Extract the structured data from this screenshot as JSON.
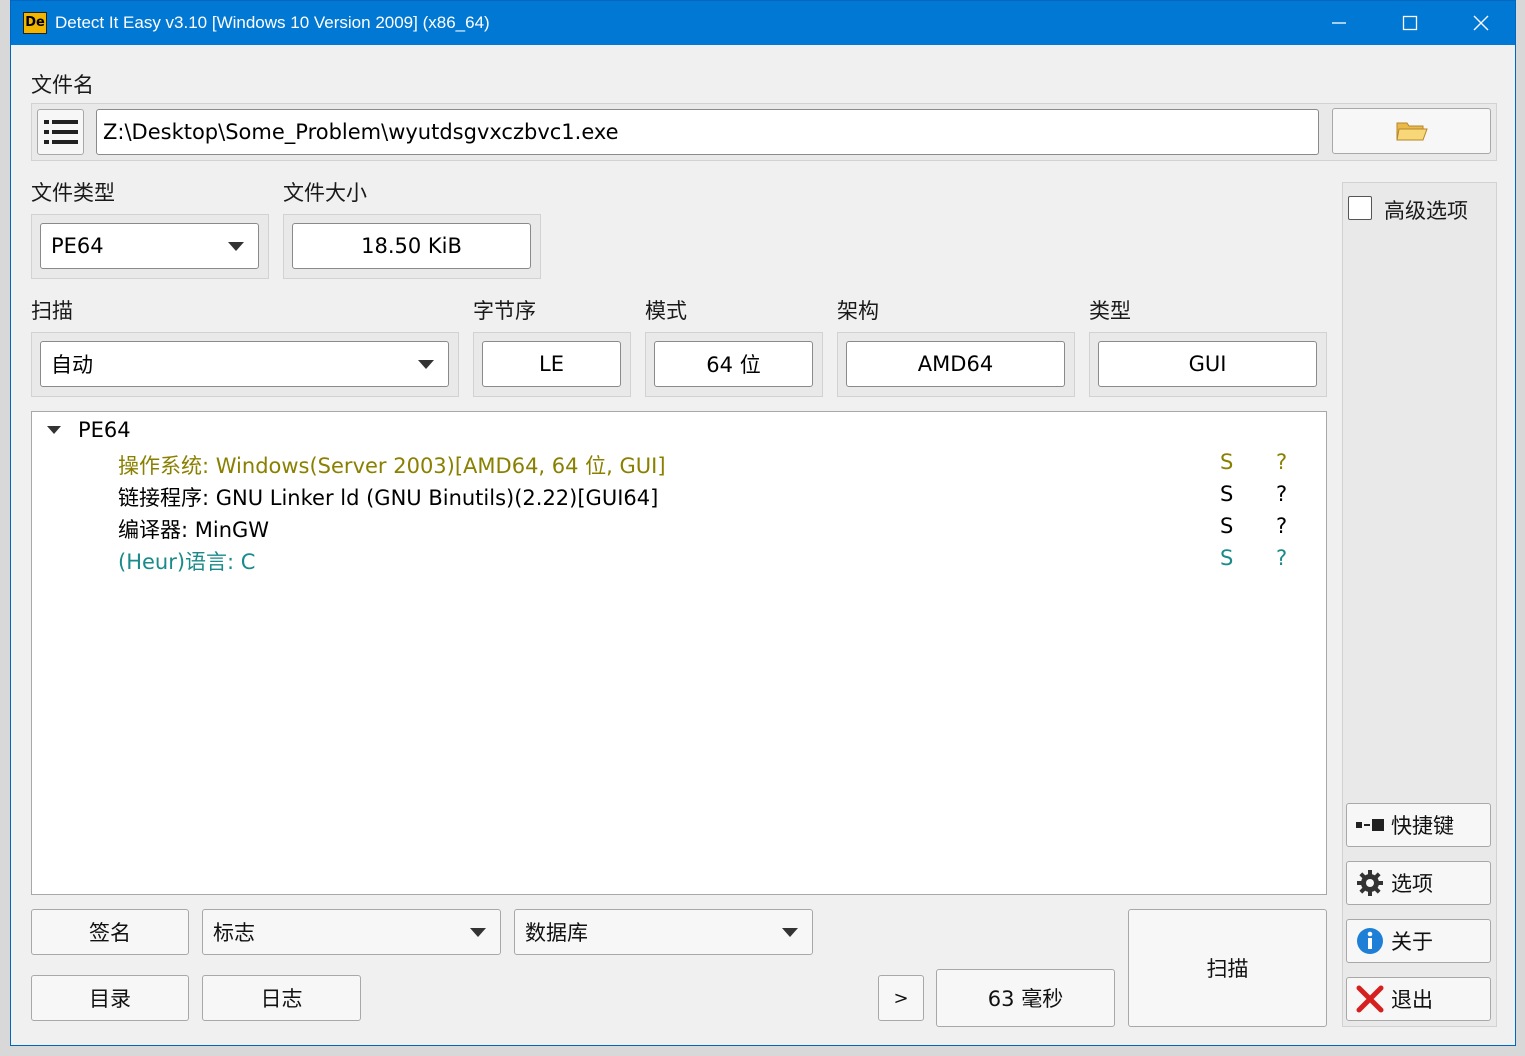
{
  "window": {
    "title": "Detect It Easy v3.10 [Windows 10 Version 2009] (x86_64)",
    "app_icon_text": "De"
  },
  "file": {
    "label": "文件名",
    "path": "Z:\\Desktop\\Some_Problem\\wyutdsgvxczbvc1.exe"
  },
  "file_type": {
    "label": "文件类型",
    "value": "PE64"
  },
  "file_size": {
    "label": "文件大小",
    "value": "18.50 KiB"
  },
  "scan": {
    "label": "扫描",
    "value": "自动"
  },
  "endianness": {
    "label": "字节序",
    "value": "LE"
  },
  "mode": {
    "label": "模式",
    "value": "64 位"
  },
  "arch": {
    "label": "架构",
    "value": "AMD64"
  },
  "type": {
    "label": "类型",
    "value": "GUI"
  },
  "advanced": {
    "label": "高级选项",
    "checked": false
  },
  "results": {
    "root": "PE64",
    "items": [
      {
        "text": "操作系统: Windows(Server 2003)[AMD64, 64 位, GUI]",
        "s": "S",
        "q": "?",
        "color": "#8a8000"
      },
      {
        "text": "链接程序: GNU Linker ld (GNU Binutils)(2.22)[GUI64]",
        "s": "S",
        "q": "?",
        "color": "#000000"
      },
      {
        "text": "编译器: MinGW",
        "s": "S",
        "q": "?",
        "color": "#000000"
      },
      {
        "text": "(Heur)语言: C",
        "s": "S",
        "q": "?",
        "color": "#1a8a8a"
      }
    ]
  },
  "bottom": {
    "signature": "签名",
    "flags": "标志",
    "database": "数据库",
    "directory": "目录",
    "log": "日志",
    "more": ">",
    "elapsed": "63 毫秒",
    "scan": "扫描"
  },
  "side": {
    "shortcuts": "快捷键",
    "options": "选项",
    "about": "关于",
    "exit": "退出"
  }
}
